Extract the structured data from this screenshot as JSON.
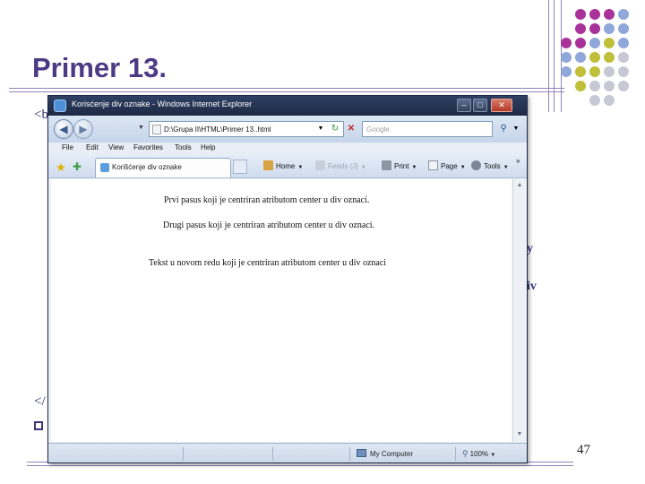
{
  "slide": {
    "title": "Primer 13.",
    "code_fragments": [
      "<b",
      "y",
      "iv",
      "</"
    ],
    "page_number": "47",
    "palette": {
      "purple": "#a8329a",
      "blue": "#8fa8d9",
      "olive": "#bfbf3a",
      "gray": "#c8c8d4"
    }
  },
  "ie_window": {
    "title": "Korisćenje div oznake - Windows Internet Explorer",
    "address": "D:\\Grupa II\\HTML\\Primer 13..html",
    "search_placeholder": "Google",
    "menu": [
      "File",
      "Edit",
      "View",
      "Favorites",
      "Tools",
      "Help"
    ],
    "tab_label": "Korišćenje div oznake",
    "toolbar": {
      "home": "Home",
      "feeds": "Feeds (J)",
      "print": "Print",
      "page": "Page",
      "tools": "Tools",
      "overflow": "»"
    },
    "content_lines": [
      "Prvi pasus koji je centriran atributom center u div oznaci.",
      "Drugi pasus koji je centriran atributom center u div oznaci.",
      "Tekst u novom redu koji je centriran atributom center u div oznaci"
    ],
    "status": {
      "zone": "My Computer",
      "zoom": "100%"
    }
  }
}
